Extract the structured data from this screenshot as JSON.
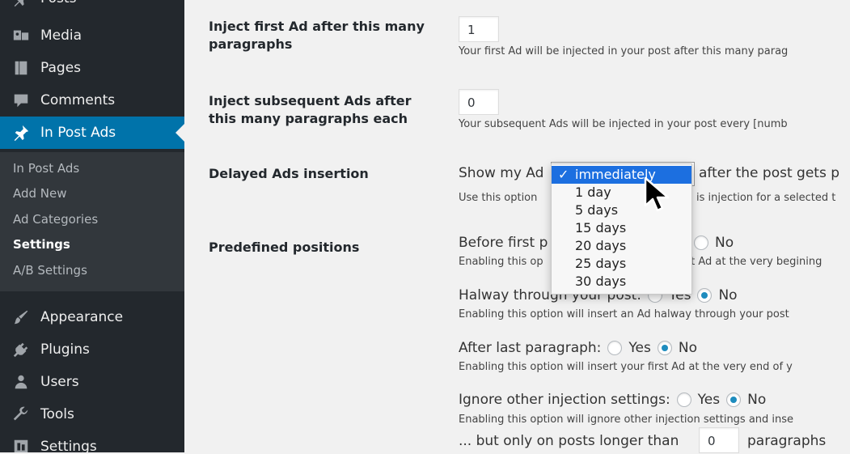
{
  "sidebar": {
    "items": [
      {
        "label": "Posts",
        "icon": "pin-icon"
      },
      {
        "label": "Media",
        "icon": "media-icon"
      },
      {
        "label": "Pages",
        "icon": "page-icon"
      },
      {
        "label": "Comments",
        "icon": "comment-icon"
      },
      {
        "label": "In Post Ads",
        "icon": "pin-icon"
      },
      {
        "label": "Appearance",
        "icon": "brush-icon"
      },
      {
        "label": "Plugins",
        "icon": "plug-icon"
      },
      {
        "label": "Users",
        "icon": "user-icon"
      },
      {
        "label": "Tools",
        "icon": "wrench-icon"
      },
      {
        "label": "Settings",
        "icon": "settings-icon"
      }
    ],
    "submenu": [
      "In Post Ads",
      "Add New",
      "Ad Categories",
      "Settings",
      "A/B Settings"
    ],
    "accent": "#0073aa"
  },
  "form": {
    "first_ad": {
      "label": "Inject first Ad after this many paragraphs",
      "value": "1",
      "desc": "Your first Ad will be injected in your post after this many parag"
    },
    "subsequent": {
      "label": "Inject subsequent Ads after this many paragraphs each",
      "value": "0",
      "desc": "Your subsequent Ads will be injected in your post every [numb"
    },
    "delayed": {
      "label": "Delayed Ads insertion",
      "prefix": "Show my Ad",
      "suffix": "after the post gets p",
      "desc_left": "Use this option",
      "desc_right": "is injection for a selected t",
      "options": [
        "immediately",
        "1 day",
        "5 days",
        "15 days",
        "20 days",
        "25 days",
        "30 days"
      ],
      "selected": "immediately",
      "check": "✓"
    },
    "predefined": {
      "label": "Predefined positions",
      "before_first": {
        "label_left": "Before first p",
        "no": "No",
        "desc_left": "Enabling this op",
        "desc_right": "rst Ad at the very begining"
      },
      "halfway": {
        "label": "Halway through your post:",
        "yes": "Yes",
        "no": "No",
        "desc": "Enabling this option will insert an Ad halway through your post"
      },
      "after_last": {
        "label": "After last paragraph:",
        "yes": "Yes",
        "no": "No",
        "desc": "Enabling this option will insert your first Ad at the very end of y"
      },
      "ignore": {
        "label": "Ignore other injection settings:",
        "yes": "Yes",
        "no": "No",
        "desc": "Enabling this option will ignore other injection settings and inse"
      },
      "only_longer": {
        "prefix": "... but only on posts longer than",
        "value": "0",
        "suffix": "paragraphs"
      }
    }
  }
}
